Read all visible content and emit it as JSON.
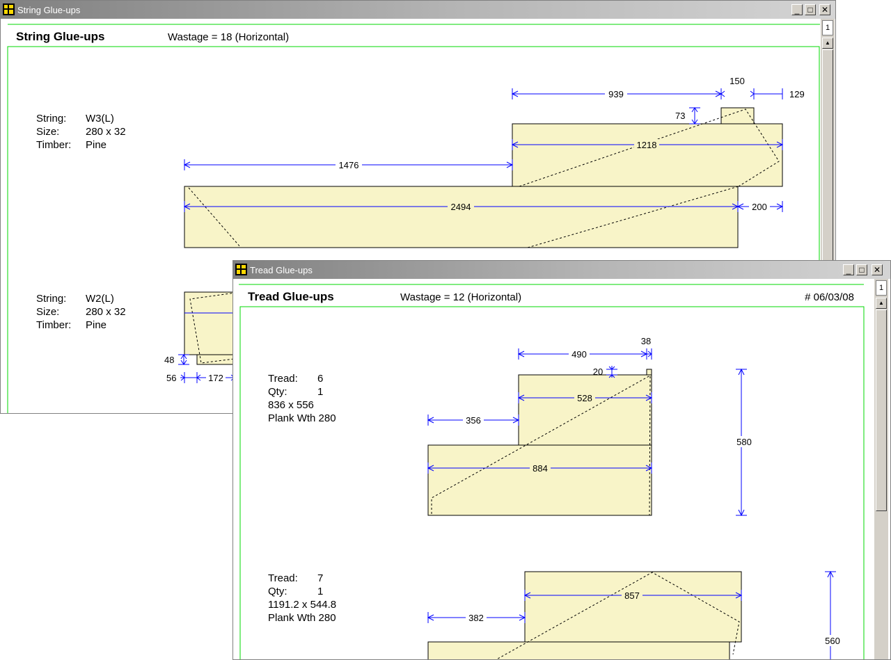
{
  "string_window": {
    "title": "String Glue-ups",
    "heading": "String Glue-ups",
    "wastage": "Wastage = 18 (Horizontal)",
    "page": "1",
    "items": [
      {
        "string_label": "String:",
        "string_value": "W3(L)",
        "size_label": "Size:",
        "size_value": "280 x 32",
        "timber_label": "Timber:",
        "timber_value": "Pine",
        "dims": [
          "939",
          "150",
          "129",
          "73",
          "1218",
          "1476",
          "2494",
          "200"
        ]
      },
      {
        "string_label": "String:",
        "string_value": "W2(L)",
        "size_label": "Size:",
        "size_value": "280 x 32",
        "timber_label": "Timber:",
        "timber_value": "Pine",
        "dims": [
          "48",
          "56",
          "172"
        ]
      }
    ]
  },
  "tread_window": {
    "title": "Tread Glue-ups",
    "heading": "Tread Glue-ups",
    "wastage": "Wastage = 12 (Horizontal)",
    "date": "#  06/03/08",
    "page": "1",
    "items": [
      {
        "tread_label": "Tread:",
        "tread_value": "6",
        "qty_label": "Qty:",
        "qty_value": "1",
        "dimensions": "836 x 556",
        "plank": "Plank Wth 280",
        "dims": [
          "490",
          "38",
          "20",
          "528",
          "356",
          "884",
          "580"
        ]
      },
      {
        "tread_label": "Tread:",
        "tread_value": "7",
        "qty_label": "Qty:",
        "qty_value": "1",
        "dimensions": "1191.2 x 544.8",
        "plank": "Plank Wth 280",
        "dims": [
          "857",
          "382",
          "560"
        ]
      }
    ]
  },
  "window_controls": {
    "minimize": "_",
    "maximize": "□",
    "close": "✕"
  },
  "colors": {
    "board_fill": "#f8f4c8",
    "dimension_line": "#0000ff",
    "frame_line": "#00d800"
  }
}
